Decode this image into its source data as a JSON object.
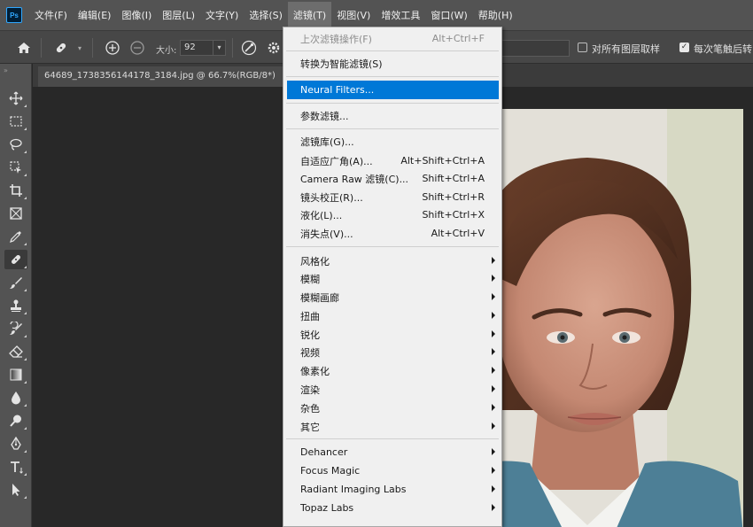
{
  "app": {
    "logo": "Ps"
  },
  "menubar": {
    "items": [
      "文件(F)",
      "编辑(E)",
      "图像(I)",
      "图层(L)",
      "文字(Y)",
      "选择(S)",
      "滤镜(T)",
      "视图(V)",
      "增效工具",
      "窗口(W)",
      "帮助(H)"
    ],
    "active_index": 6
  },
  "options_bar": {
    "size_label": "大小:",
    "size_value": "92",
    "sample_all_layers": "对所有图层取样",
    "sample_all_checked": false,
    "stroke_option": "每次笔触后转",
    "stroke_option_checked": true
  },
  "document": {
    "tab_title": "64689_1738356144178_3184.jpg @ 66.7%(RGB/8*)"
  },
  "filter_menu": {
    "last_filter": {
      "label": "上次滤镜操作(F)",
      "shortcut": "Alt+Ctrl+F"
    },
    "convert_smart": {
      "label": "转换为智能滤镜(S)"
    },
    "neural_filters": {
      "label": "Neural Filters..."
    },
    "parametric": {
      "label": "参数滤镜..."
    },
    "gallery": {
      "label": "滤镜库(G)..."
    },
    "adaptive_wide": {
      "label": "自适应广角(A)...",
      "shortcut": "Alt+Shift+Ctrl+A"
    },
    "camera_raw": {
      "label": "Camera Raw 滤镜(C)...",
      "shortcut": "Shift+Ctrl+A"
    },
    "lens_correction": {
      "label": "镜头校正(R)...",
      "shortcut": "Shift+Ctrl+R"
    },
    "liquify": {
      "label": "液化(L)...",
      "shortcut": "Shift+Ctrl+X"
    },
    "vanishing_point": {
      "label": "消失点(V)...",
      "shortcut": "Alt+Ctrl+V"
    },
    "submenus": [
      "风格化",
      "模糊",
      "模糊画廊",
      "扭曲",
      "锐化",
      "视频",
      "像素化",
      "渲染",
      "杂色",
      "其它"
    ],
    "plugins": [
      "Dehancer",
      "Focus Magic",
      "Radiant Imaging Labs",
      "Topaz Labs"
    ]
  }
}
